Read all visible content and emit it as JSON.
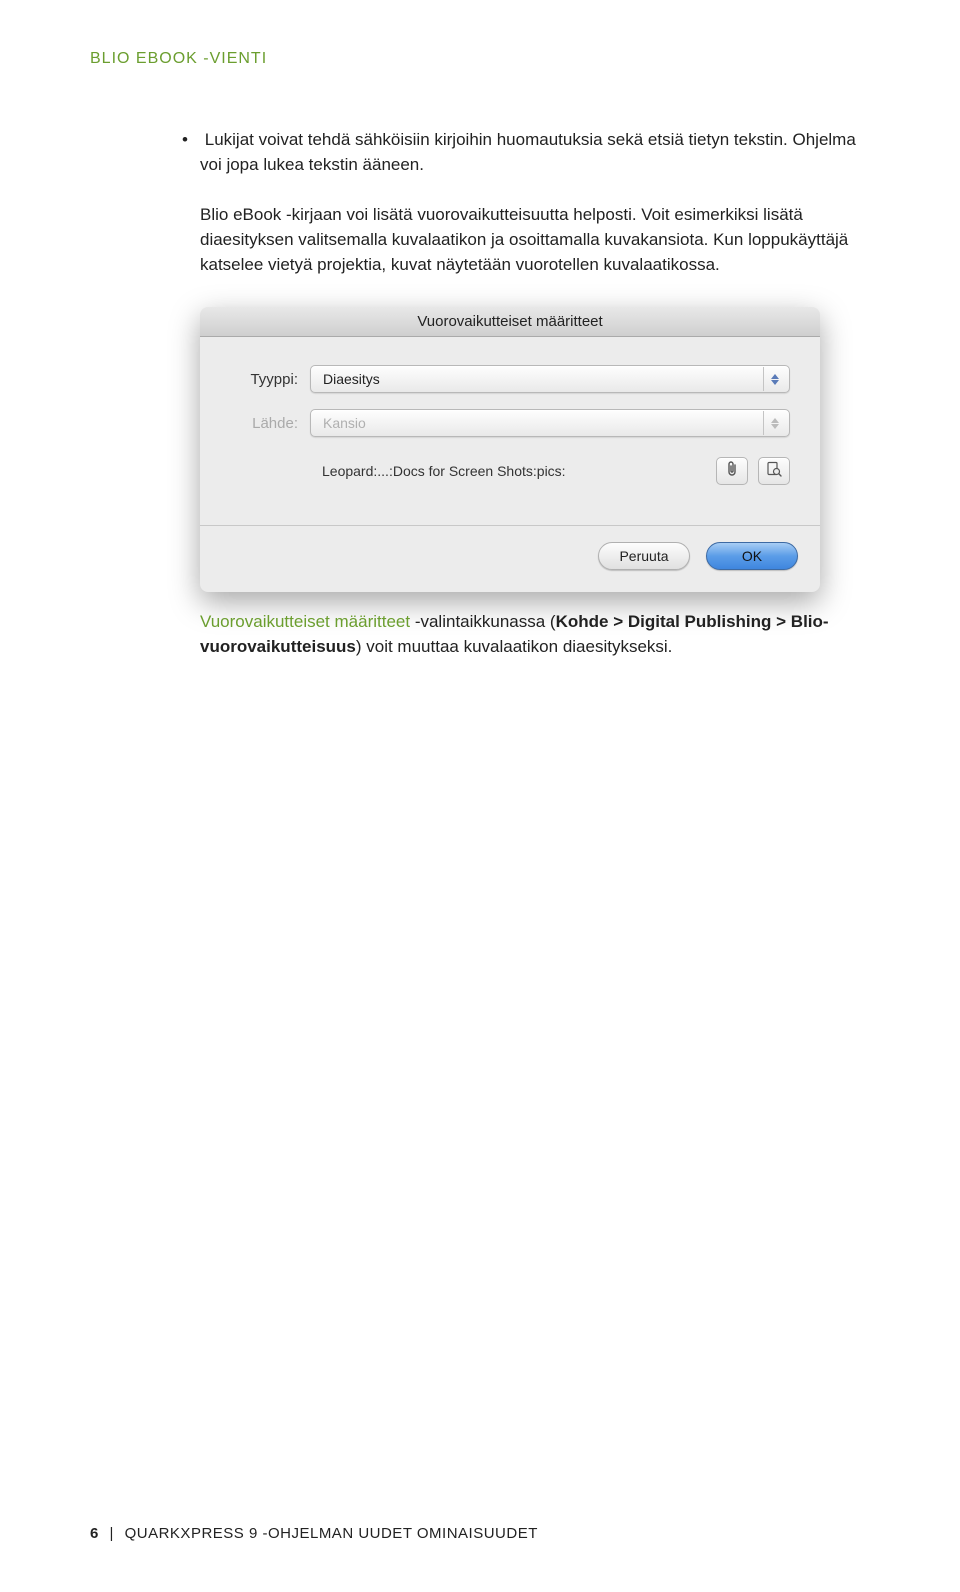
{
  "header": {
    "breadcrumb": "BLIO EBOOK -VIENTI"
  },
  "bullet": {
    "text": "Lukijat voivat tehdä sähköisiin kirjoihin huomautuksia sekä etsiä tietyn tekstin. Ohjelma voi jopa lukea tekstin ääneen."
  },
  "paragraph": {
    "text": "Blio eBook -kirjaan voi lisätä vuorovaikutteisuutta helposti. Voit esimerkiksi lisätä diaesityksen valitsemalla kuvalaatikon ja osoittamalla kuvakansiota. Kun loppukäyttäjä katselee vietyä projektia, kuvat näytetään vuorotellen kuvalaatikossa."
  },
  "dialog": {
    "title": "Vuorovaikutteiset määritteet",
    "type_label": "Tyyppi:",
    "type_value": "Diaesitys",
    "source_label": "Lähde:",
    "source_value": "Kansio",
    "path": "Leopard:...:Docs for Screen Shots:pics:",
    "cancel": "Peruuta",
    "ok": "OK"
  },
  "caption": {
    "green1": "Vuorovaikutteiset määritteet",
    "mid1": " -valintaikkunassa (",
    "bold1": "Kohde > Digital Publishing > Blio-vuorovaikutteisuus",
    "mid2": ") voit muuttaa kuvalaatikon diaesitykseksi."
  },
  "footer": {
    "page": "6",
    "title": "QUARKXPRESS 9 -OHJELMAN UUDET OMINAISUUDET"
  }
}
